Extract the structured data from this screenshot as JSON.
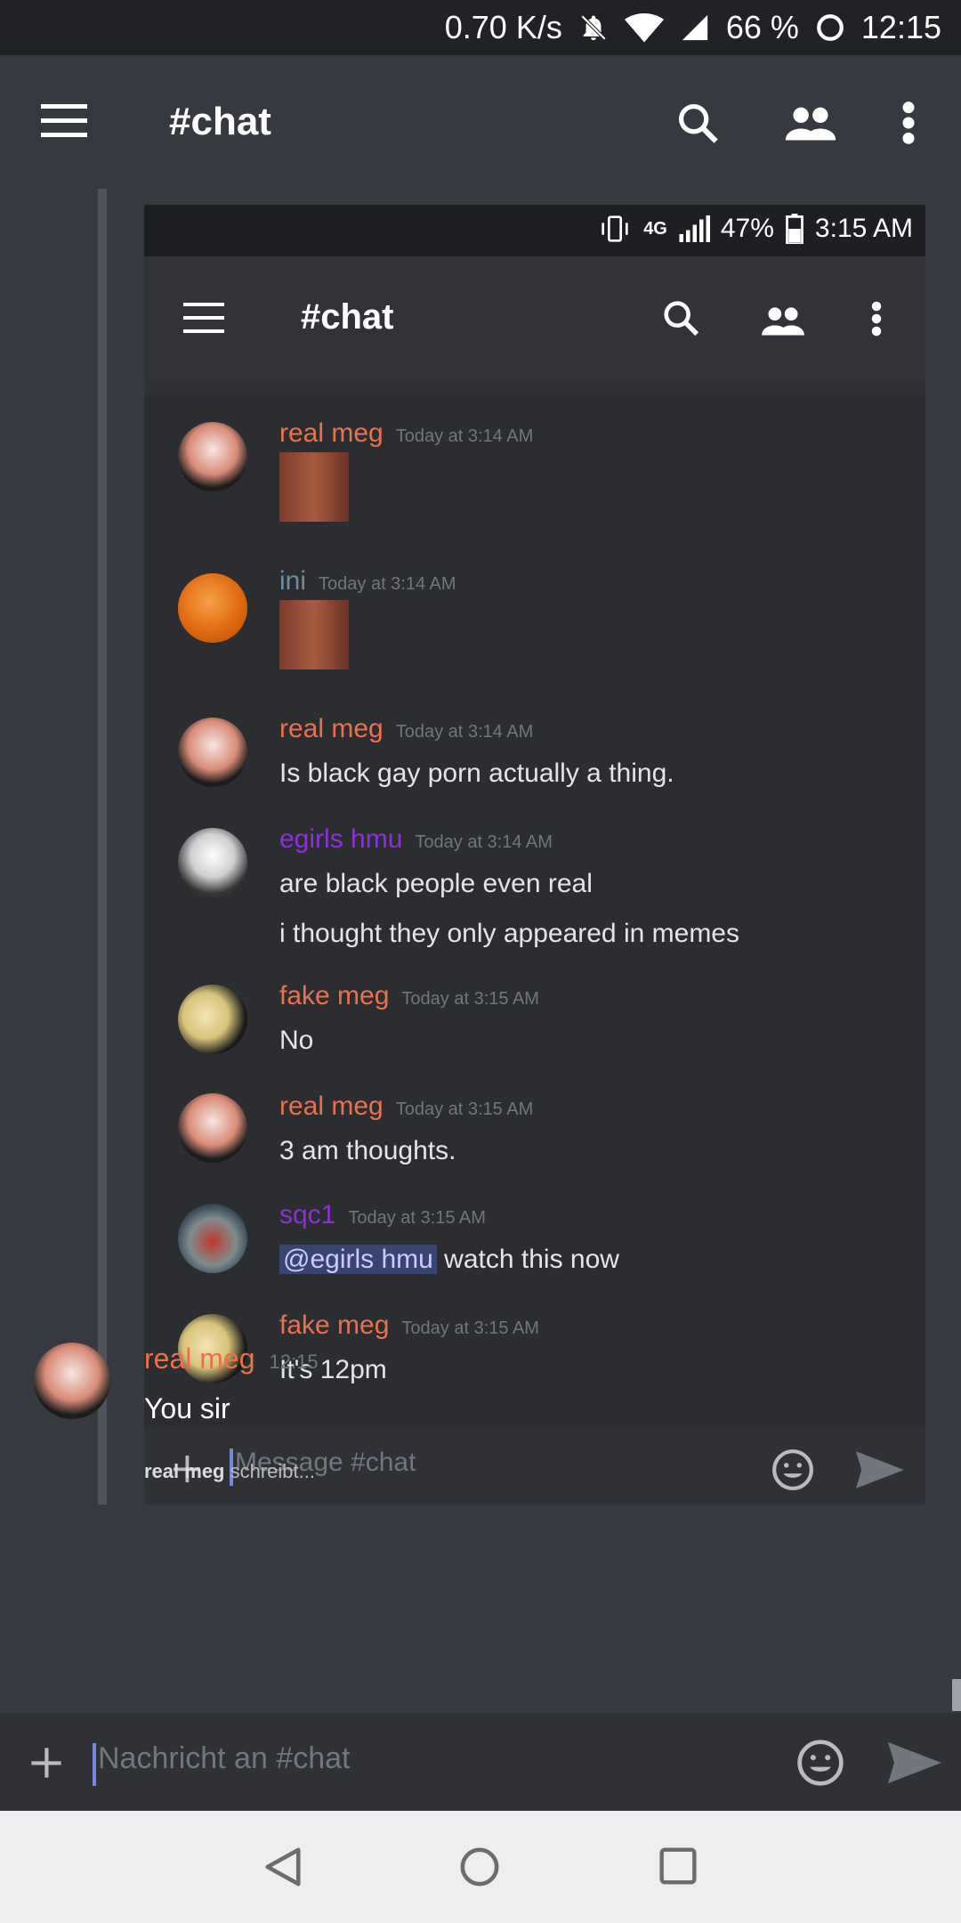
{
  "status_bar": {
    "speed": "0.70 K/s",
    "battery": "66 %",
    "time": "12:15"
  },
  "app_bar": {
    "title": "#chat"
  },
  "embedded_screenshot": {
    "status_bar": {
      "network": "4G",
      "battery": "47%",
      "time": "3:15 AM"
    },
    "app_bar": {
      "title": "#chat"
    },
    "messages": [
      {
        "author": "real meg",
        "time": "Today at 3:14 AM",
        "lines": [],
        "author_color": "#e8724d"
      },
      {
        "author": "ini",
        "time": "Today at 3:14 AM",
        "lines": [],
        "author_color": "#6c8ea0"
      },
      {
        "author": "real meg",
        "time": "Today at 3:14 AM",
        "lines": [
          "Is black gay porn actually a thing."
        ],
        "author_color": "#e8724d"
      },
      {
        "author": "egirls hmu",
        "time": "Today at 3:14 AM",
        "lines": [
          "are black people even real",
          "i thought they only appeared in memes"
        ],
        "author_color": "#8e2fd8"
      },
      {
        "author": "fake meg",
        "time": "Today at 3:15 AM",
        "lines": [
          "No"
        ],
        "author_color": "#e8724d"
      },
      {
        "author": "real meg",
        "time": "Today at 3:15 AM",
        "lines": [
          "3 am thoughts."
        ],
        "author_color": "#e8724d"
      },
      {
        "author": "sqc1",
        "time": "Today at 3:15 AM",
        "mention": "@egirls hmu",
        "lines": [
          " watch this now"
        ],
        "author_color": "#8e2fd8"
      },
      {
        "author": "fake meg",
        "time": "Today at 3:15 AM",
        "lines": [
          "It's 12pm"
        ],
        "author_color": "#e8724d"
      }
    ],
    "input_placeholder": "Message #chat"
  },
  "main_message": {
    "author": "real meg",
    "time": "12:15",
    "text": "You sir"
  },
  "typing": {
    "user": "real meg",
    "suffix": " schreibt..."
  },
  "input": {
    "placeholder": "Nachricht an #chat"
  }
}
